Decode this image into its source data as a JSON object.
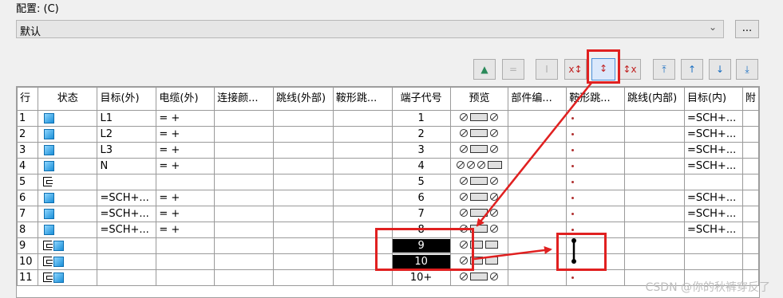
{
  "config": {
    "label": "配置: (C)",
    "value": "默认",
    "more_label": "..."
  },
  "toolbar": {
    "buttons": [
      {
        "name": "shift-up-alt-icon",
        "glyph": "▲"
      },
      {
        "name": "equals-icon",
        "glyph": "="
      },
      {
        "name": "jumper-disabled-icon",
        "glyph": "I"
      },
      {
        "name": "jumper-add-x-icon",
        "glyph": "x↕"
      },
      {
        "name": "jumper-insert-icon",
        "glyph": "↕"
      },
      {
        "name": "jumper-remove-icon",
        "glyph": "↕x"
      },
      {
        "name": "move-top-icon",
        "glyph": "⤒"
      },
      {
        "name": "move-up-icon",
        "glyph": "↑"
      },
      {
        "name": "move-down-icon",
        "glyph": "↓"
      },
      {
        "name": "move-bottom-icon",
        "glyph": "⤓"
      }
    ]
  },
  "grid": {
    "headers": [
      "行",
      "状态",
      "目标(外)",
      "电缆(外)",
      "连接颜...",
      "跳线(外部)",
      "鞍形跳...",
      "端子代号",
      "预览",
      "部件编...",
      "鞍形跳...",
      "跳线(内部)",
      "目标(内)",
      "附"
    ],
    "rows": [
      {
        "n": "1",
        "status": "cube",
        "target_out": "L1",
        "cable": "= +",
        "term": "1",
        "preview": "std",
        "target_in": "=SCH+..."
      },
      {
        "n": "2",
        "status": "cube",
        "target_out": "L2",
        "cable": "= +",
        "term": "2",
        "preview": "std",
        "target_in": "=SCH+..."
      },
      {
        "n": "3",
        "status": "cube",
        "target_out": "L3",
        "cable": "= +",
        "term": "3",
        "preview": "std",
        "target_in": "=SCH+..."
      },
      {
        "n": "4",
        "status": "cube",
        "target_out": "N",
        "cable": "= +",
        "term": "4",
        "preview": "triple",
        "target_in": "=SCH+..."
      },
      {
        "n": "5",
        "status": "brk",
        "target_out": "",
        "cable": "",
        "term": "5",
        "preview": "std",
        "target_in": ""
      },
      {
        "n": "6",
        "status": "cube",
        "target_out": "=SCH+...",
        "cable": "= +",
        "term": "6",
        "preview": "std",
        "target_in": "=SCH+..."
      },
      {
        "n": "7",
        "status": "cube",
        "target_out": "=SCH+...",
        "cable": "= +",
        "term": "7",
        "preview": "std",
        "target_in": "=SCH+..."
      },
      {
        "n": "8",
        "status": "cube",
        "target_out": "=SCH+...",
        "cable": "= +",
        "term": "8",
        "preview": "std",
        "target_in": "=SCH+..."
      },
      {
        "n": "9",
        "status": "brkcube",
        "target_out": "",
        "cable": "",
        "term": "9",
        "preview": "std2",
        "target_in": "",
        "selected": true
      },
      {
        "n": "10",
        "status": "brkcube",
        "target_out": "",
        "cable": "",
        "term": "10",
        "preview": "std2",
        "target_in": "",
        "selected": true
      },
      {
        "n": "11",
        "status": "brkcube",
        "target_out": "",
        "cable": "",
        "term": "10+",
        "preview": "std",
        "target_in": ""
      }
    ]
  },
  "watermark": "CSDN @你的秋裤穿反了",
  "colors": {
    "highlight": "#e02020",
    "selected_bg": "#000000",
    "toolbar_active_bg": "#dbe8fb"
  }
}
